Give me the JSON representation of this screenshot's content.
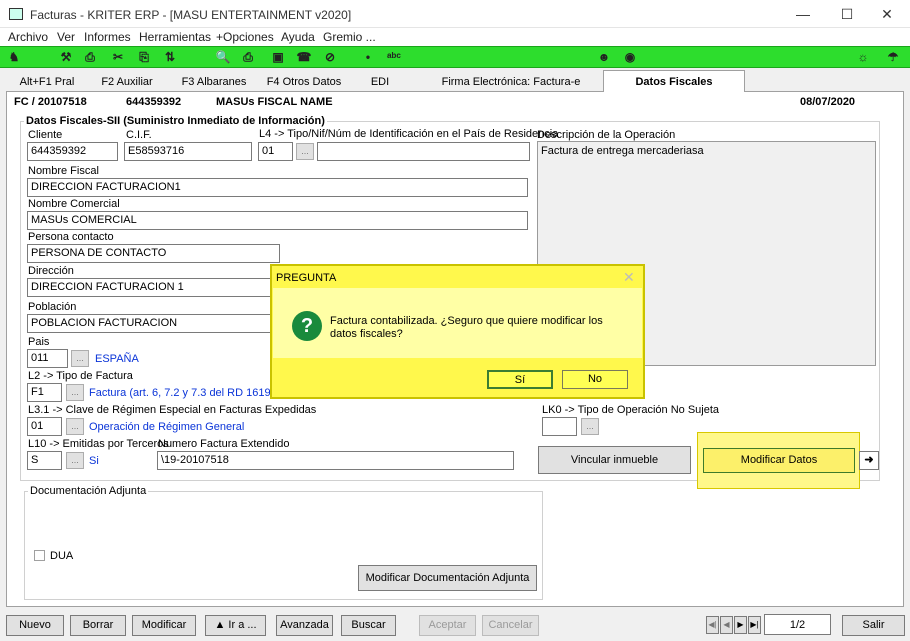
{
  "window": {
    "title": "Facturas - KRITER ERP - [MASU ENTERTAINMENT v2020]",
    "minimize": "—",
    "maximize": "☐",
    "close": "✕"
  },
  "menu": [
    "Archivo",
    "Ver",
    "Informes",
    "Herramientas",
    "+Opciones",
    "Ayuda",
    "Gremio ..."
  ],
  "tabs": [
    "Alt+F1 Pral",
    "F2 Auxiliar",
    "F3 Albaranes",
    "F4 Otros Datos",
    "EDI",
    "Firma Electrónica: Factura-e",
    "Datos Fiscales"
  ],
  "header": {
    "doc": "FC / 20107518",
    "cif": "644359392",
    "name": "MASUs FISCAL NAME",
    "date": "08/07/2020"
  },
  "sii": {
    "group_title": "Datos Fiscales-SII (Suministro Inmediato de Información)",
    "cliente_label": "Cliente",
    "cliente": "644359392",
    "cif_label": "C.I.F.",
    "cif": "E58593716",
    "l4_label": "L4 -> Tipo/Nif/Núm de Identificación en el País de Residencia",
    "l4_tipo": "01",
    "l4_num": "",
    "desc_label": "Descripción de la Operación",
    "desc": "Factura de entrega mercaderiasa",
    "nombre_fiscal_label": "Nombre Fiscal",
    "nombre_fiscal": "DIRECCION FACTURACION1",
    "nombre_comercial_label": "Nombre Comercial",
    "nombre_comercial": "MASUs COMERCIAL",
    "persona_label": "Persona contacto",
    "persona": "PERSONA DE CONTACTO",
    "direccion_label": "Dirección",
    "direccion": "DIRECCION FACTURACION 1",
    "poblacion_label": "Población",
    "poblacion": "POBLACION FACTURACION",
    "pais_label": "Pais",
    "pais_code": "011",
    "pais_name": "ESPAÑA",
    "l2_label": "L2 -> Tipo de Factura",
    "l2_code": "F1",
    "l2_desc": "Factura (art. 6, 7.2 y 7.3 del RD 1619/2012",
    "l31_label": "L3.1 -> Clave de Régimen Especial en Facturas Expedidas",
    "l31_code": "01",
    "l31_desc": "Operación de Régimen General",
    "l10_label": "L10 -> Emitidas por Terceros",
    "l10_code": "S",
    "l10_desc": "Si",
    "num_ext_label": "Numero Factura Extendido",
    "num_ext": "\\19-20107518",
    "lk0_label": "LK0 -> Tipo de Operación No Sujeta",
    "lk0_code": ""
  },
  "buttons": {
    "vincular": "Vincular inmueble",
    "modificar_datos": "Modificar Datos",
    "arrow": "➜"
  },
  "docs": {
    "title": "Documentación Adjunta",
    "dua": "DUA",
    "modificar": "Modificar Documentación Adjunta"
  },
  "bottom": {
    "nuevo": "Nuevo",
    "borrar": "Borrar",
    "modificar": "Modificar",
    "ir": "▲ Ir a ...",
    "avanzada": "Avanzada",
    "buscar": "Buscar",
    "aceptar": "Aceptar",
    "cancelar": "Cancelar",
    "page": "1/2",
    "salir": "Salir"
  },
  "dialog": {
    "title": "PREGUNTA",
    "close": "✕",
    "icon": "?",
    "message": "Factura contabilizada. ¿Seguro que quiere modificar los datos fiscales?",
    "yes": "Sí",
    "no": "No"
  },
  "colors": {
    "toolbar": "#2ddd2d",
    "dialog": "#fff84c",
    "link": "#0a34d8"
  }
}
